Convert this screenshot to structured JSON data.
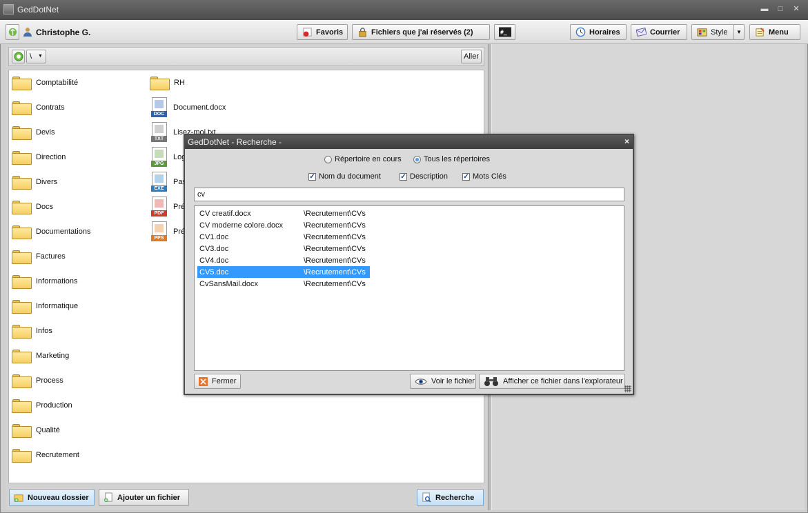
{
  "window": {
    "title": "GedDotNet"
  },
  "toolbar": {
    "user_name": "Christophe G.",
    "favoris": "Favoris",
    "reserved": "Fichiers que j'ai réservés (2)",
    "horaires": "Horaires",
    "courrier": "Courrier",
    "style": "Style",
    "menu": "Menu"
  },
  "left": {
    "go_label": "Aller",
    "folders": [
      "Comptabilité",
      "Contrats",
      "Devis",
      "Direction",
      "Divers",
      "Docs",
      "Documentations",
      "Factures",
      "Informations",
      "Informatique",
      "Infos",
      "Marketing",
      "Process",
      "Production",
      "Qualité",
      "Recrutement"
    ],
    "folder2": "RH",
    "files": [
      {
        "name": "Document.docx",
        "tag": "DOC",
        "color": "#2a63b8"
      },
      {
        "name": "Lisez-moi.txt",
        "tag": "TXT",
        "color": "#777777"
      },
      {
        "name": "Log",
        "tag": "JPG",
        "color": "#5a9a3a"
      },
      {
        "name": "Pas",
        "tag": "EXE",
        "color": "#2a7fc4"
      },
      {
        "name": "Pré",
        "tag": "PDF",
        "color": "#d03a2a"
      },
      {
        "name": "Pré",
        "tag": "PPS",
        "color": "#e07a20"
      }
    ],
    "new_folder": "Nouveau dossier",
    "add_file": "Ajouter un fichier",
    "search": "Recherche"
  },
  "dialog": {
    "title": "GedDotNet - Recherche -",
    "radio_current": "Répertoire en cours",
    "radio_all": "Tous les répertoires",
    "chk_name": "Nom du document",
    "chk_desc": "Description",
    "chk_keys": "Mots Clés",
    "query": "cv",
    "results": [
      {
        "name": "CV creatif.docx",
        "path": "\\Recrutement\\CVs"
      },
      {
        "name": "CV moderne colore.docx",
        "path": "\\Recrutement\\CVs"
      },
      {
        "name": "CV1.doc",
        "path": "\\Recrutement\\CVs"
      },
      {
        "name": "CV3.doc",
        "path": "\\Recrutement\\CVs"
      },
      {
        "name": "CV4.doc",
        "path": "\\Recrutement\\CVs"
      },
      {
        "name": "CV5.doc",
        "path": "\\Recrutement\\CVs"
      },
      {
        "name": "CvSansMail.docx",
        "path": "\\Recrutement\\CVs"
      }
    ],
    "selected_index": 5,
    "close": "Fermer",
    "view": "Voir le fichier",
    "explore": "Afficher ce fichier dans l'explorateur"
  }
}
